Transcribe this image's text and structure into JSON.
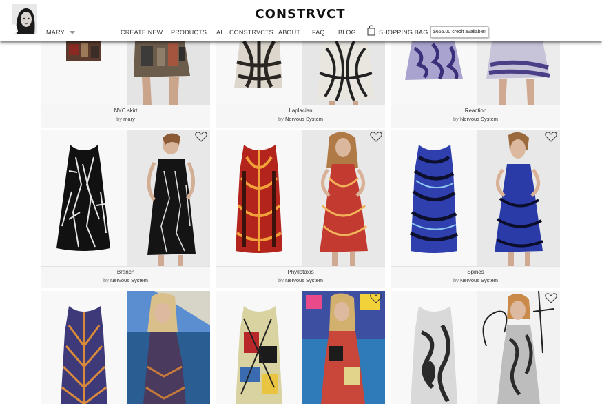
{
  "header": {
    "logo": "CONSTRVCT",
    "user_name": "MARY",
    "nav": [
      "CREATE NEW",
      "PRODUCTS",
      "ALL CONSTRVCTS",
      "ABOUT",
      "FAQ",
      "BLOG"
    ],
    "bag_label": "SHOPPING BAG",
    "credit_text": "$665.00 credit available!"
  },
  "products": [
    {
      "name": "NYC skirt",
      "by_prefix": "by",
      "author": "mary"
    },
    {
      "name": "Laplacian",
      "by_prefix": "by",
      "author": "Nervous System"
    },
    {
      "name": "Reaction",
      "by_prefix": "by",
      "author": "Nervous System"
    },
    {
      "name": "Branch",
      "by_prefix": "by",
      "author": "Nervous System"
    },
    {
      "name": "Phyllotaxis",
      "by_prefix": "by",
      "author": "Nervous System"
    },
    {
      "name": "Spines",
      "by_prefix": "by",
      "author": "Nervous System"
    },
    {
      "name": "",
      "by_prefix": "",
      "author": ""
    },
    {
      "name": "",
      "by_prefix": "",
      "author": ""
    },
    {
      "name": "",
      "by_prefix": "",
      "author": ""
    }
  ],
  "icons": {
    "favorite": "heart-outline-icon",
    "bag": "shopping-bag-icon",
    "dropdown": "chevron-down-icon"
  }
}
